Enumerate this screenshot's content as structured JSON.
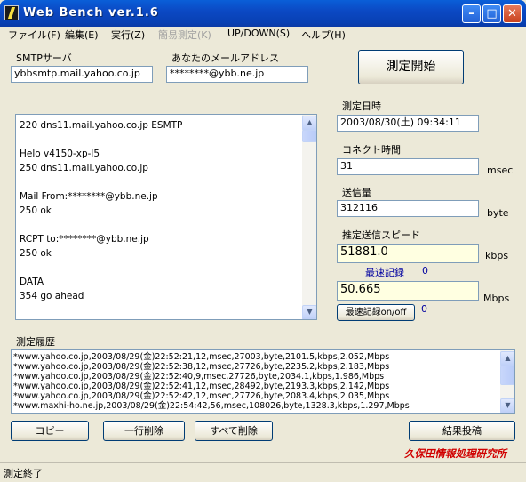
{
  "window": {
    "title": "Web Bench ver.1.6"
  },
  "menu": [
    {
      "label": "ファイル(F)",
      "enabled": true
    },
    {
      "label": "編集(E)",
      "enabled": true
    },
    {
      "label": "実行(Z)",
      "enabled": true
    },
    {
      "label": "簡易測定(K)",
      "enabled": false
    },
    {
      "label": "UP/DOWN(S)",
      "enabled": true
    },
    {
      "label": "ヘルプ(H)",
      "enabled": true
    }
  ],
  "smtp": {
    "label": "SMTPサーバ",
    "value": "ybbsmtp.mail.yahoo.co.jp"
  },
  "email": {
    "label": "あなたのメールアドレス",
    "value": "********@ybb.ne.jp"
  },
  "start_button": "測定開始",
  "log_lines": [
    "220 dns11.mail.yahoo.co.jp ESMTP",
    "",
    "Helo v4150-xp-l5",
    "250 dns11.mail.yahoo.co.jp",
    "",
    "Mail From:********@ybb.ne.jp",
    "250 ok",
    "",
    "RCPT to:********@ybb.ne.jp",
    "250 ok",
    "",
    "DATA",
    "354 go ahead",
    ""
  ],
  "fields": {
    "datetime": {
      "label": "測定日時",
      "value": "2003/08/30(土) 09:34:11"
    },
    "connect": {
      "label": "コネクト時間",
      "value": "31",
      "unit": "msec"
    },
    "sent": {
      "label": "送信量",
      "value": "312116",
      "unit": "byte"
    },
    "speed": {
      "label": "推定送信スピード",
      "kbps": "51881.0",
      "kbps_unit": "kbps",
      "mbps": "50.665",
      "mbps_unit": "Mbps"
    },
    "best_label": "最速記録",
    "best_value": "0",
    "best_toggle": "最速記録on/off",
    "best_toggle_value": "0"
  },
  "history": {
    "label": "測定履歴",
    "lines": [
      "*www.yahoo.co.jp,2003/08/29(金)22:52:21,12,msec,27003,byte,2101.5,kbps,2.052,Mbps",
      "*www.yahoo.co.jp,2003/08/29(金)22:52:38,12,msec,27726,byte,2235.2,kbps,2.183,Mbps",
      "*www.yahoo.co.jp,2003/08/29(金)22:52:40,9,msec,27726,byte,2034.1,kbps,1.986,Mbps",
      "*www.yahoo.co.jp,2003/08/29(金)22:52:41,12,msec,28492,byte,2193.3,kbps,2.142,Mbps",
      "*www.yahoo.co.jp,2003/08/29(金)22:52:42,12,msec,27726,byte,2083.4,kbps,2.035,Mbps",
      "*www.maxhi-ho.ne.jp,2003/08/29(金)22:54:42,56,msec,108026,byte,1328.3,kbps,1.297,Mbps"
    ]
  },
  "buttons": {
    "copy": "コピー",
    "delete_line": "一行削除",
    "delete_all": "すべて削除",
    "post": "結果投稿"
  },
  "credit": "久保田情報処理研究所",
  "status": "測定終了"
}
